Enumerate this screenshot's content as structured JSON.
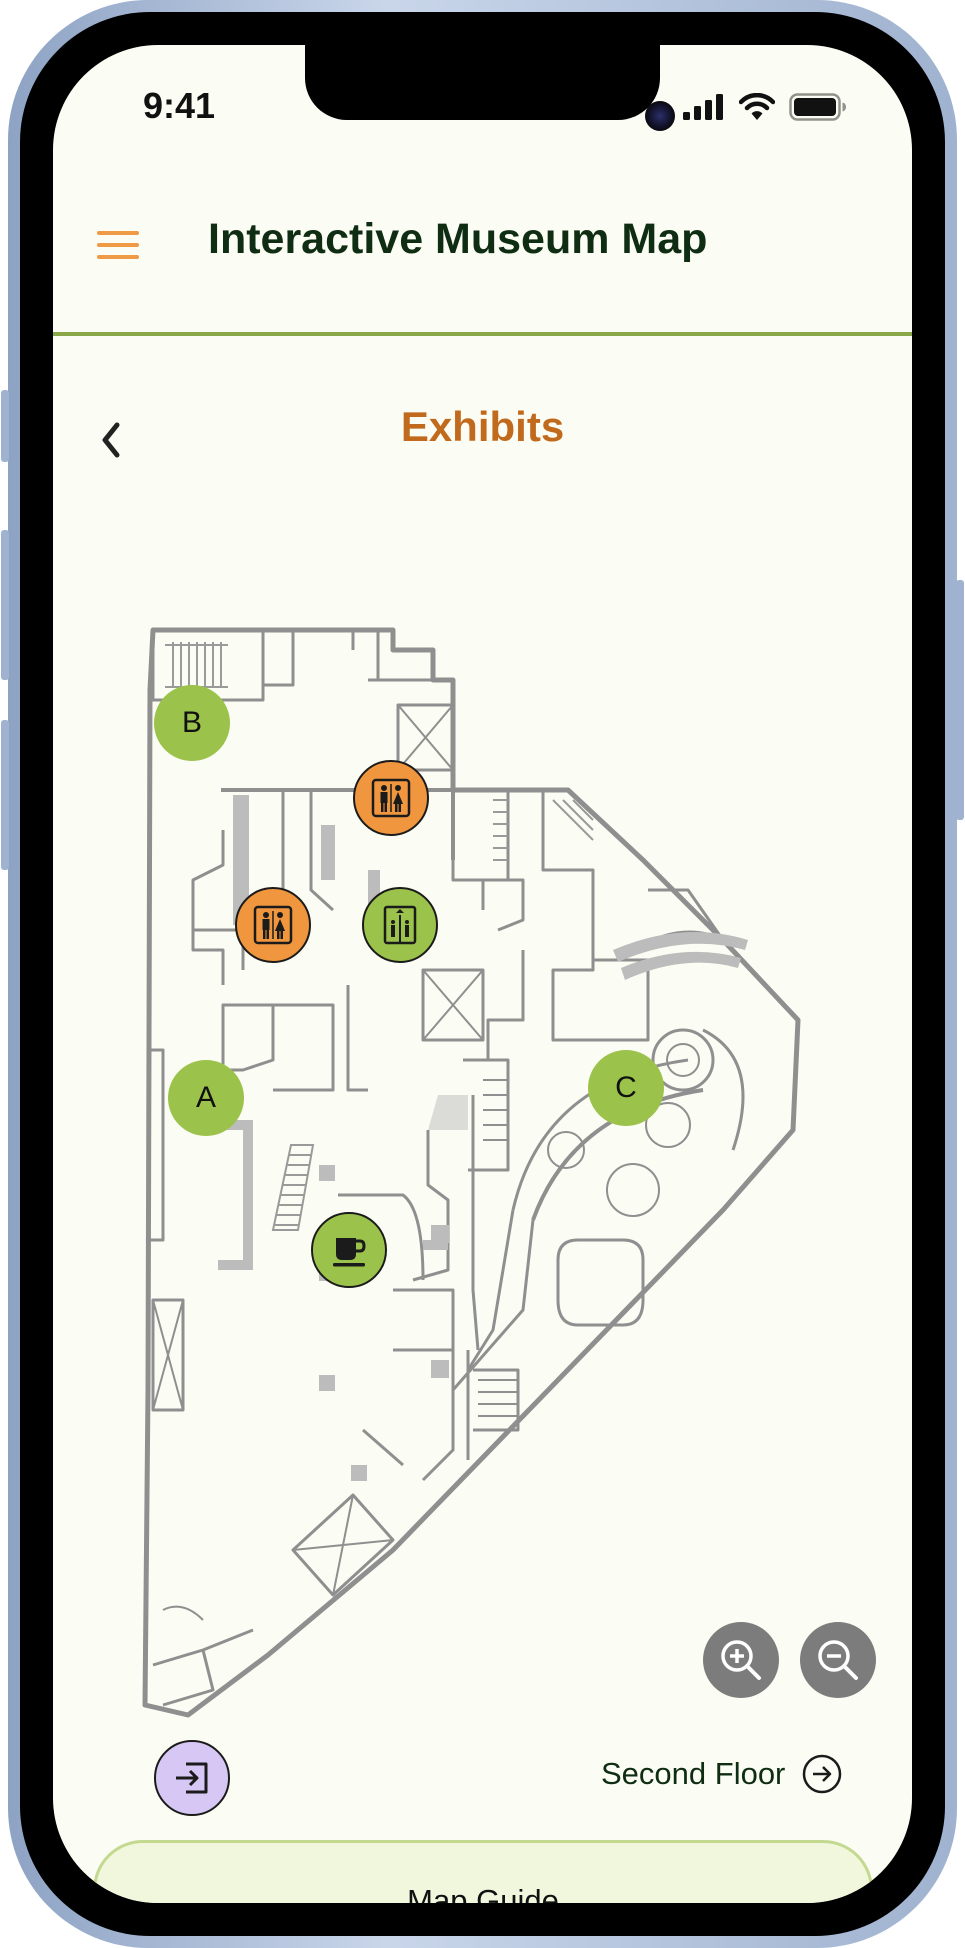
{
  "status_bar": {
    "time": "9:41"
  },
  "header": {
    "title": "Interactive Museum Map",
    "menu_icon": "hamburger-menu-icon",
    "accent_color": "#ef9a45",
    "divider_color": "#8aa74a"
  },
  "exhibits": {
    "title": "Exhibits",
    "back_icon": "chevron-left-icon",
    "title_color": "#c16a1e"
  },
  "map": {
    "markers": [
      {
        "id": "B",
        "label": "B",
        "color": "#9bc24a"
      },
      {
        "id": "A",
        "label": "A",
        "color": "#9bc24a"
      },
      {
        "id": "C",
        "label": "C",
        "color": "#9bc24a"
      },
      {
        "id": "restroom-1",
        "icon": "restroom-icon",
        "color": "#f0963f"
      },
      {
        "id": "restroom-2",
        "icon": "restroom-icon",
        "color": "#f0963f"
      },
      {
        "id": "elevator",
        "icon": "elevator-icon",
        "color": "#9bc24a"
      },
      {
        "id": "cafe",
        "icon": "coffee-cup-icon",
        "color": "#9bc24a"
      },
      {
        "id": "entrance",
        "icon": "entrance-icon",
        "color": "#d7c7f5"
      }
    ],
    "zoom_in_icon": "zoom-in-icon",
    "zoom_out_icon": "zoom-out-icon"
  },
  "second_floor": {
    "label": "Second Floor",
    "icon": "arrow-right-circle-icon"
  },
  "guide": {
    "title": "Map Guide"
  }
}
